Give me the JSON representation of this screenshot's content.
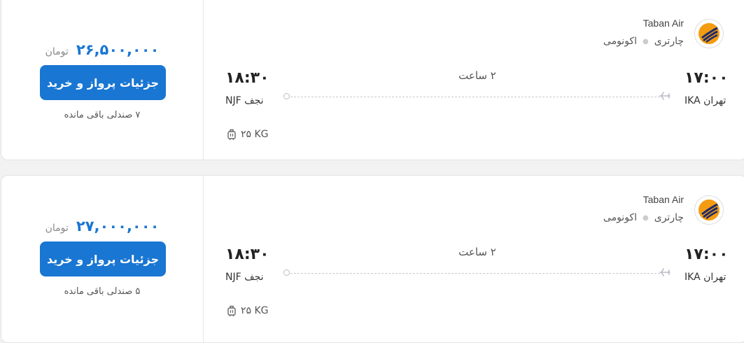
{
  "colors": {
    "accent": "#1976d2",
    "logo_orange": "#f39c12",
    "logo_navy": "#1f2a6b"
  },
  "flights": [
    {
      "price": "۲۶,۵۰۰,۰۰۰",
      "currency": "تومان",
      "buy_label": "جزئیات پرواز و خرید",
      "seats": "۷ صندلی باقی مانده",
      "airline": "Taban Air",
      "flight_type": "چارتری",
      "cabin": "اکونومی",
      "departure_time": "۱۷:۰۰",
      "departure_city": "تهران IKA",
      "arrival_time": "۱۸:۳۰",
      "arrival_city": "نجف NJF",
      "duration": "۲ ساعت",
      "baggage": "۲۵ KG"
    },
    {
      "price": "۲۷,۰۰۰,۰۰۰",
      "currency": "تومان",
      "buy_label": "جزئیات پرواز و خرید",
      "seats": "۵ صندلی باقی مانده",
      "airline": "Taban Air",
      "flight_type": "چارتری",
      "cabin": "اکونومی",
      "departure_time": "۱۷:۰۰",
      "departure_city": "تهران IKA",
      "arrival_time": "۱۸:۳۰",
      "arrival_city": "نجف NJF",
      "duration": "۲ ساعت",
      "baggage": "۲۵ KG"
    }
  ],
  "icons": {
    "logo": "taban-air-logo",
    "plane": "plane-icon",
    "baggage": "luggage-icon"
  }
}
